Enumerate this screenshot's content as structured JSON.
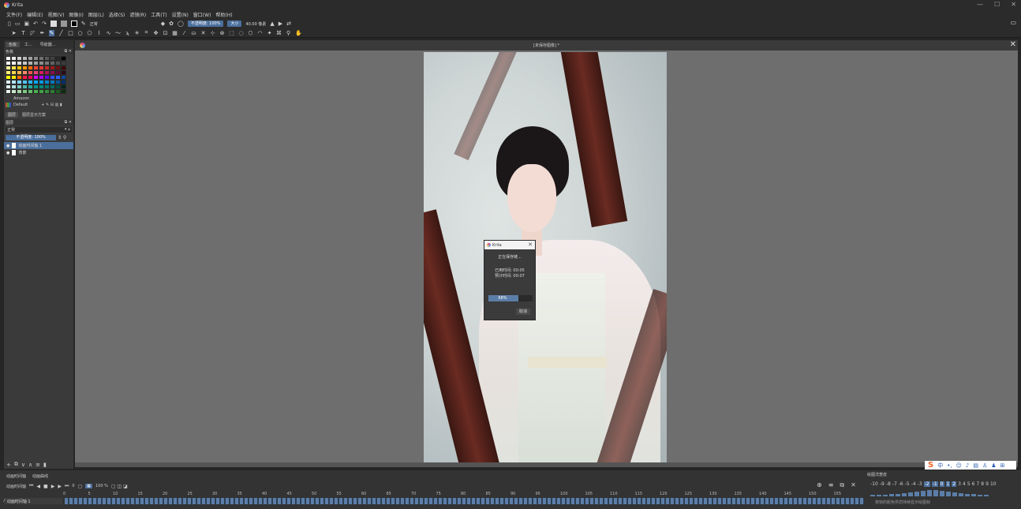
{
  "window": {
    "title": "Krita",
    "controls": [
      "—",
      "☐",
      "✕"
    ]
  },
  "menu": [
    "文件(F)",
    "编辑(E)",
    "视图(V)",
    "图像(I)",
    "图层(L)",
    "选择(S)",
    "滤镜(R)",
    "工具(T)",
    "设置(N)",
    "窗口(W)",
    "帮助(H)"
  ],
  "toolbar1": {
    "blend_mode": "正常",
    "opacity": "不透明度: 100%",
    "size_label": "大小",
    "size_value": "40.00 像素"
  },
  "left_panel": {
    "tabs": [
      "色板",
      "工...",
      "导航器..."
    ],
    "palette_header": "色板",
    "palette_name": "Amazon",
    "palette_preset": "Default",
    "layer_tabs": [
      "图层",
      "图层显示方案"
    ],
    "layers_header": "图层",
    "blend_mode": "正常",
    "opacity": "不透明度: 100%",
    "layers": [
      {
        "name": "动画时间轴 1",
        "selected": true
      },
      {
        "name": "背景",
        "selected": false
      }
    ]
  },
  "canvas": {
    "document_title": "[未保存图像] *"
  },
  "dialog": {
    "title": "Krita",
    "message": "正在保存链...",
    "elapsed": "已用时间: 00:05",
    "estimated": "预计时间: 00:07",
    "progress_text": "68%",
    "progress_value": 0.68,
    "cancel": "取消"
  },
  "animation": {
    "tabs": [
      "动画时间轴",
      "动画曲线"
    ],
    "panel_label": "动画时间轴",
    "frame": "0",
    "zoom": "100 %",
    "layer_name": "动画时间轴 1",
    "ruler": [
      "0",
      "5",
      "10",
      "15",
      "20",
      "25",
      "30",
      "35",
      "40",
      "45",
      "50",
      "55",
      "60",
      "65",
      "70",
      "75",
      "80",
      "85",
      "90",
      "95",
      "100",
      "105",
      "110",
      "115",
      "120",
      "125",
      "130",
      "135",
      "140",
      "145",
      "150",
      "155"
    ]
  },
  "onion": {
    "header": "绘图洋葱皮",
    "numbers": [
      "-10",
      "-9",
      "-8",
      "-7",
      "-6",
      "-5",
      "-4",
      "-3",
      "-2",
      "-1",
      "0",
      "1",
      "2",
      "3",
      "4",
      "5",
      "6",
      "7",
      "8",
      "9",
      "10"
    ],
    "hint": "按帧的颜色供您持续显示绘图帧"
  },
  "ime": {
    "label": "中"
  }
}
